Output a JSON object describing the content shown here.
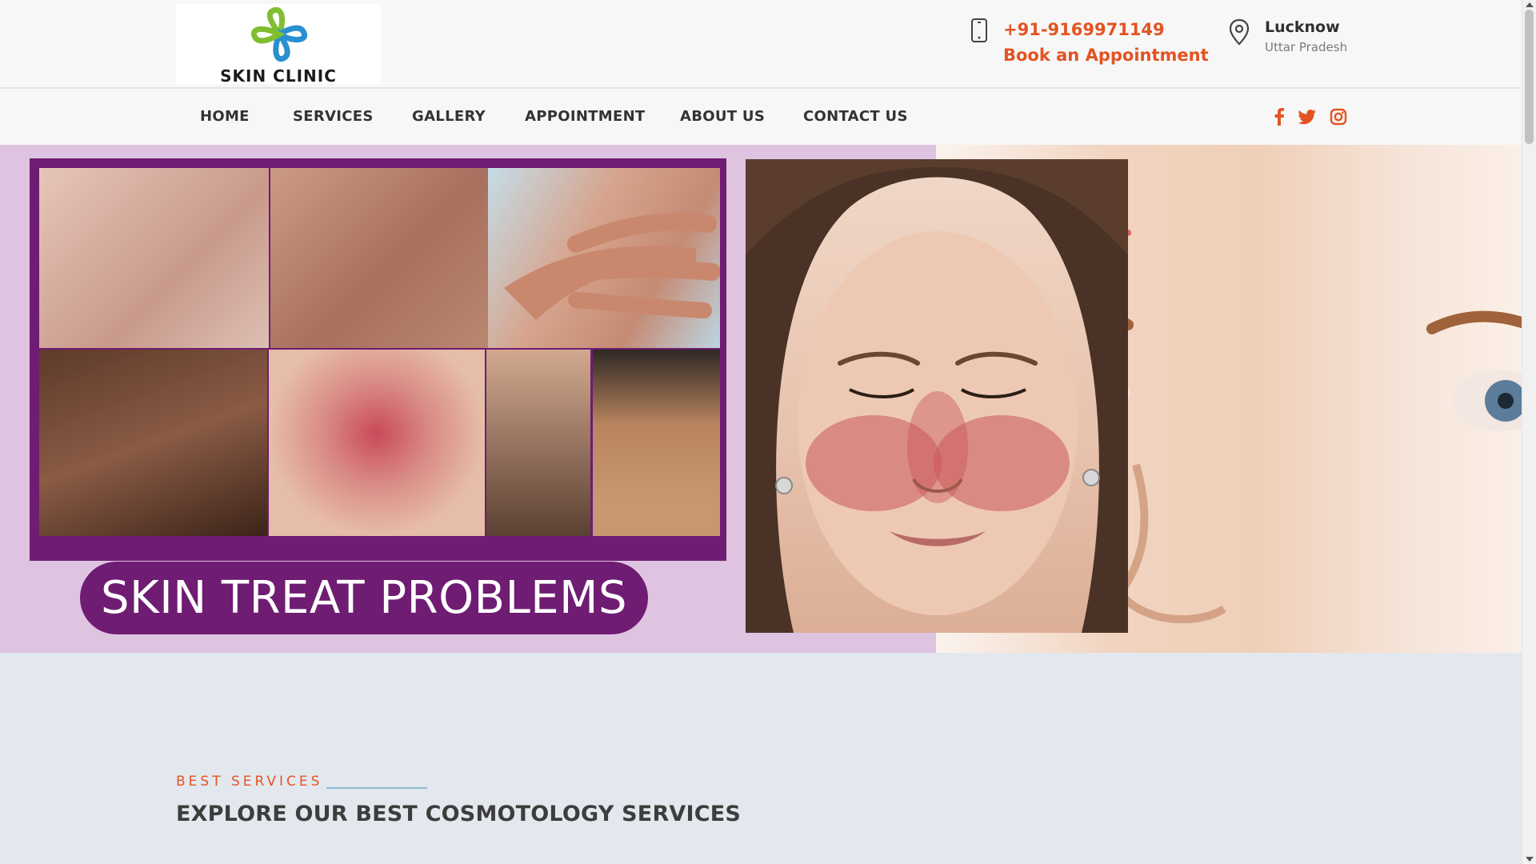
{
  "header": {
    "logo_text": "SKIN CLINIC",
    "phone": "+91-9169971149",
    "appointment_label": "Book an Appointment",
    "city": "Lucknow",
    "state": "Uttar Pradesh"
  },
  "nav": {
    "items": [
      {
        "label": "HOME"
      },
      {
        "label": "SERVICES"
      },
      {
        "label": "GALLERY"
      },
      {
        "label": "APPOINTMENT"
      },
      {
        "label": "ABOUT US"
      },
      {
        "label": "CONTACT US"
      }
    ],
    "social": [
      "facebook-icon",
      "twitter-icon",
      "instagram-icon"
    ]
  },
  "hero": {
    "banner_text": "SKIN TREAT PROBLEMS"
  },
  "services": {
    "tag": "BEST SERVICES",
    "title": "EXPLORE OUR BEST COSMOTOLOGY SERVICES"
  },
  "colors": {
    "accent": "#e35322",
    "purple": "#6f1c73",
    "hero_bg": "#dec4e0",
    "section_bg": "#e3e8ef"
  }
}
